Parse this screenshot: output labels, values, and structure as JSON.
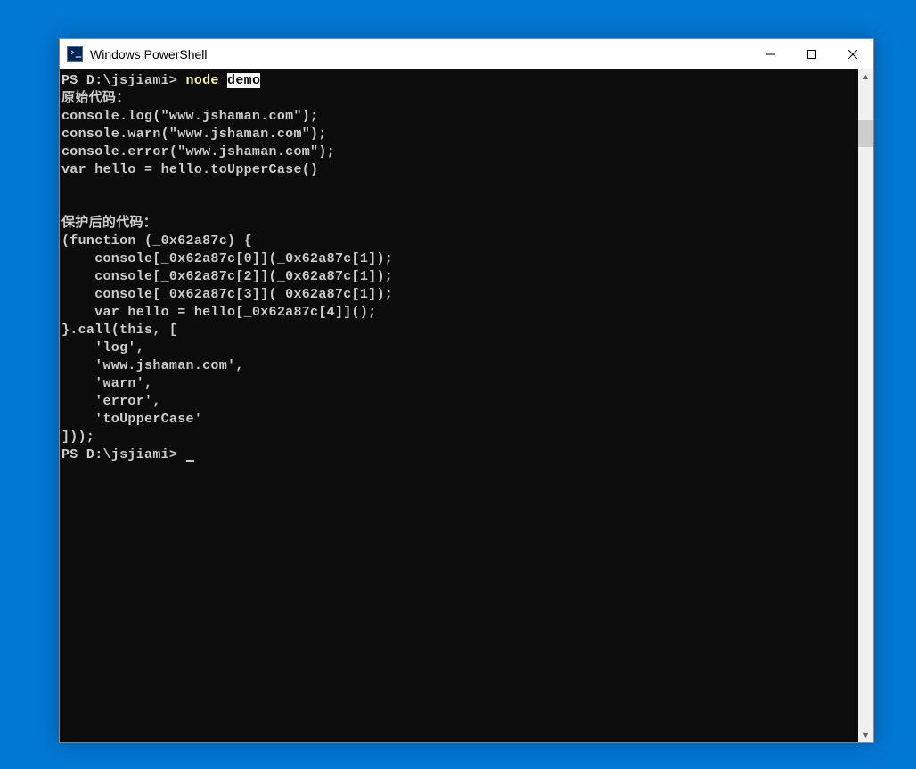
{
  "window": {
    "title": "Windows PowerShell"
  },
  "terminal": {
    "prompt1_prefix": "PS D:\\jsjiami> ",
    "cmd_node": "node ",
    "cmd_demo": "demo",
    "section1_header": "原始代码：",
    "line_log": "console.log(\"www.jshaman.com\");",
    "line_warn": "console.warn(\"www.jshaman.com\");",
    "line_error": "console.error(\"www.jshaman.com\");",
    "line_var": "var hello = hello.toUpperCase()",
    "blank": "",
    "section2_header": "保护后的代码：",
    "ob_l1": "(function (_0x62a87c) {",
    "ob_l2": "    console[_0x62a87c[0]](_0x62a87c[1]);",
    "ob_l3": "    console[_0x62a87c[2]](_0x62a87c[1]);",
    "ob_l4": "    console[_0x62a87c[3]](_0x62a87c[1]);",
    "ob_l5": "    var hello = hello[_0x62a87c[4]]();",
    "ob_l6": "}.call(this, [",
    "ob_l7": "    'log',",
    "ob_l8": "    'www.jshaman.com',",
    "ob_l9": "    'warn',",
    "ob_l10": "    'error',",
    "ob_l11": "    'toUpperCase'",
    "ob_l12": "]));",
    "prompt2_prefix": "PS D:\\jsjiami> "
  }
}
